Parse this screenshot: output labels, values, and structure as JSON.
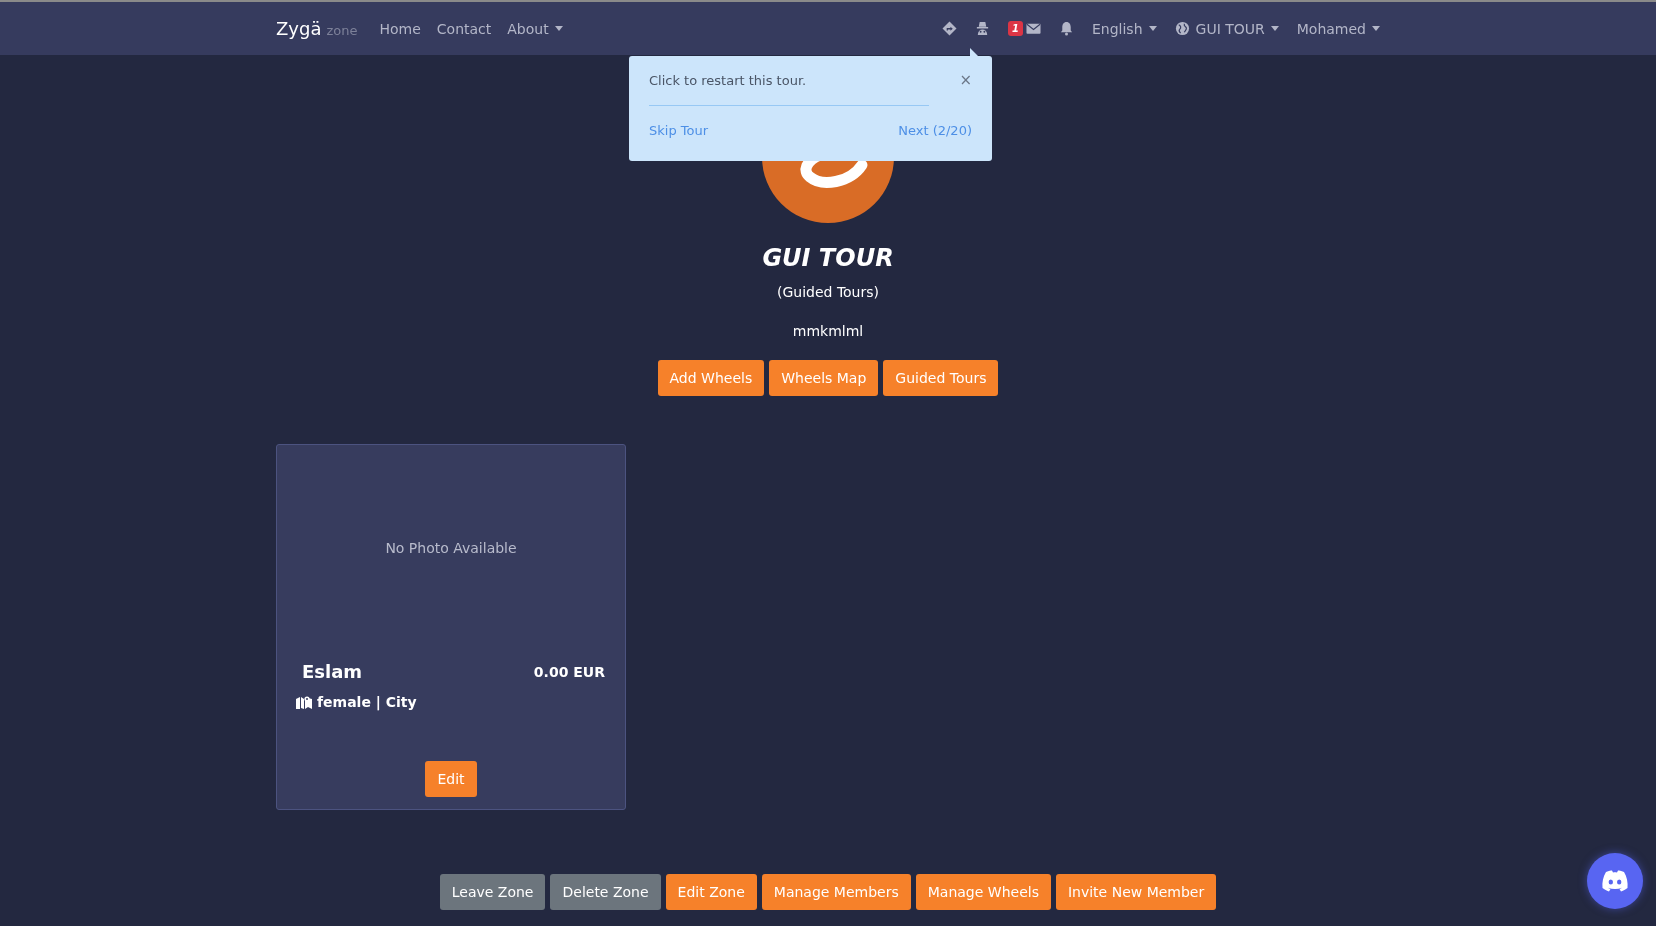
{
  "navbar": {
    "brand": "Zygä",
    "brand_suffix": "zone",
    "links": [
      {
        "label": "Home",
        "kind": "link"
      },
      {
        "label": "Contact",
        "kind": "link"
      },
      {
        "label": "About",
        "kind": "dropdown"
      }
    ],
    "icons": [
      {
        "kind": "directions"
      },
      {
        "kind": "incognito"
      },
      {
        "kind": "mail",
        "badge": "1"
      },
      {
        "kind": "bell"
      }
    ],
    "menus": [
      {
        "label": "English",
        "kind": "dropdown"
      },
      {
        "label": "GUI TOUR",
        "kind": "globe-dropdown"
      },
      {
        "label": "Mohamed",
        "kind": "dropdown"
      }
    ]
  },
  "tour_popover": {
    "message": "Click to restart this tour.",
    "close": "×",
    "skip": "Skip Tour",
    "next": "Next (2/20)"
  },
  "profile": {
    "title": "GUI TOUR",
    "subtitle": "(Guided Tours)",
    "description": "mmkmlml",
    "buttons": [
      "Add Wheels",
      "Wheels Map",
      "Guided Tours"
    ]
  },
  "cards": [
    {
      "photo_placeholder": "No Photo Available",
      "name": "Eslam",
      "price": "0.00 EUR",
      "details": "female | City",
      "button": "Edit"
    }
  ],
  "actions": [
    {
      "label": "Leave Zone",
      "kind": "secondary"
    },
    {
      "label": "Delete Zone",
      "kind": "secondary"
    },
    {
      "label": "Edit Zone",
      "kind": "primary"
    },
    {
      "label": "Manage Members",
      "kind": "primary"
    },
    {
      "label": "Manage Wheels",
      "kind": "primary"
    },
    {
      "label": "Invite New Member",
      "kind": "primary"
    }
  ]
}
